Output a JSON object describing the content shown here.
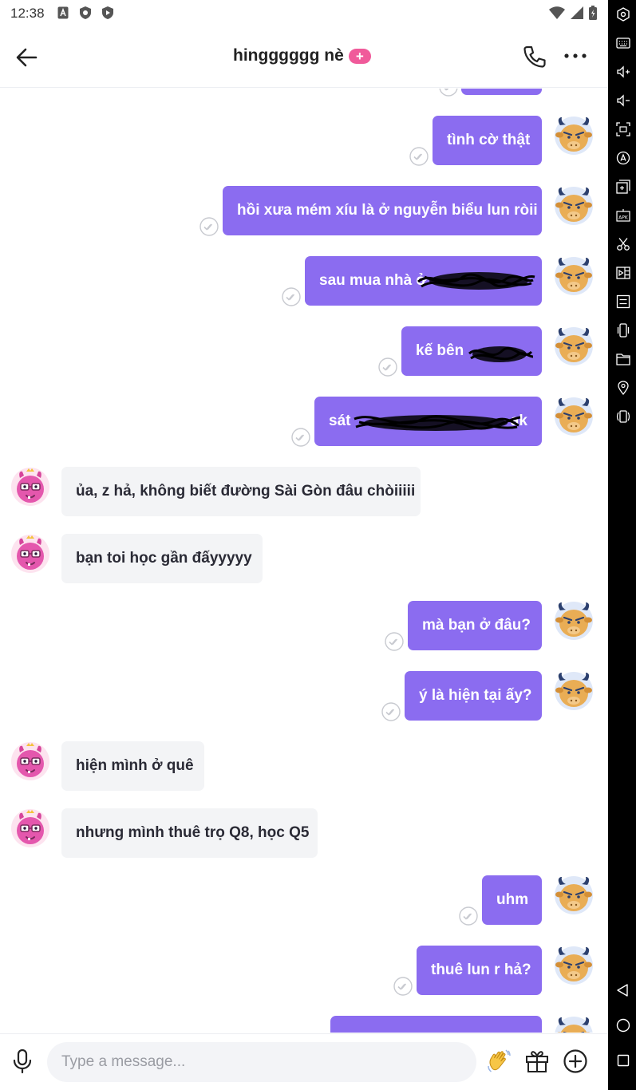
{
  "status_bar": {
    "time": "12:38",
    "left_icons": [
      "a-badge-icon",
      "shield-icon",
      "shield-icon"
    ],
    "right_icons": [
      "wifi-icon",
      "signal-icon",
      "battery-icon"
    ]
  },
  "header": {
    "title": "hingggggg nè",
    "badge": "+",
    "icons": [
      "back-arrow-icon",
      "phone-icon",
      "more-dots-icon"
    ]
  },
  "messages": [
    {
      "side": "out",
      "text": "tình cờ thật",
      "status": "delivered"
    },
    {
      "side": "out",
      "text": "hồi xưa mém xíu là ở nguyễn biểu lun ròii",
      "status": "delivered"
    },
    {
      "side": "out",
      "text": "sau mua nhà ở",
      "status": "delivered",
      "redacted": true
    },
    {
      "side": "out",
      "text": "kế bên",
      "status": "delivered",
      "redacted": true
    },
    {
      "side": "out",
      "text": "sát",
      "tail": "ak",
      "status": "delivered",
      "redacted": true
    },
    {
      "side": "in",
      "text": "ủa, z hả, không biết đường Sài Gòn đâu chòiiiii"
    },
    {
      "side": "in",
      "text": "bạn toi học gần đấyyyyy"
    },
    {
      "side": "out",
      "text": "mà bạn ở đâu?",
      "status": "delivered"
    },
    {
      "side": "out",
      "text": "ý là hiện tại ấy?",
      "status": "delivered"
    },
    {
      "side": "in",
      "text": "hiện mình ở quê"
    },
    {
      "side": "in",
      "text": "nhưng mình thuê trọ Q8, học Q5"
    },
    {
      "side": "out",
      "text": "uhm",
      "status": "delivered"
    },
    {
      "side": "out",
      "text": "thuê lun r hả?",
      "status": "delivered"
    }
  ],
  "composer": {
    "placeholder": "Type a message...",
    "icons": [
      "mic-icon",
      "wave-hand-icon",
      "gift-icon",
      "add-circle-icon"
    ]
  },
  "colors": {
    "outgoing_bubble": "#8b6cf0",
    "incoming_bubble": "#f3f4f6",
    "badge": "#f05a9a",
    "side_panel": "#000000"
  }
}
